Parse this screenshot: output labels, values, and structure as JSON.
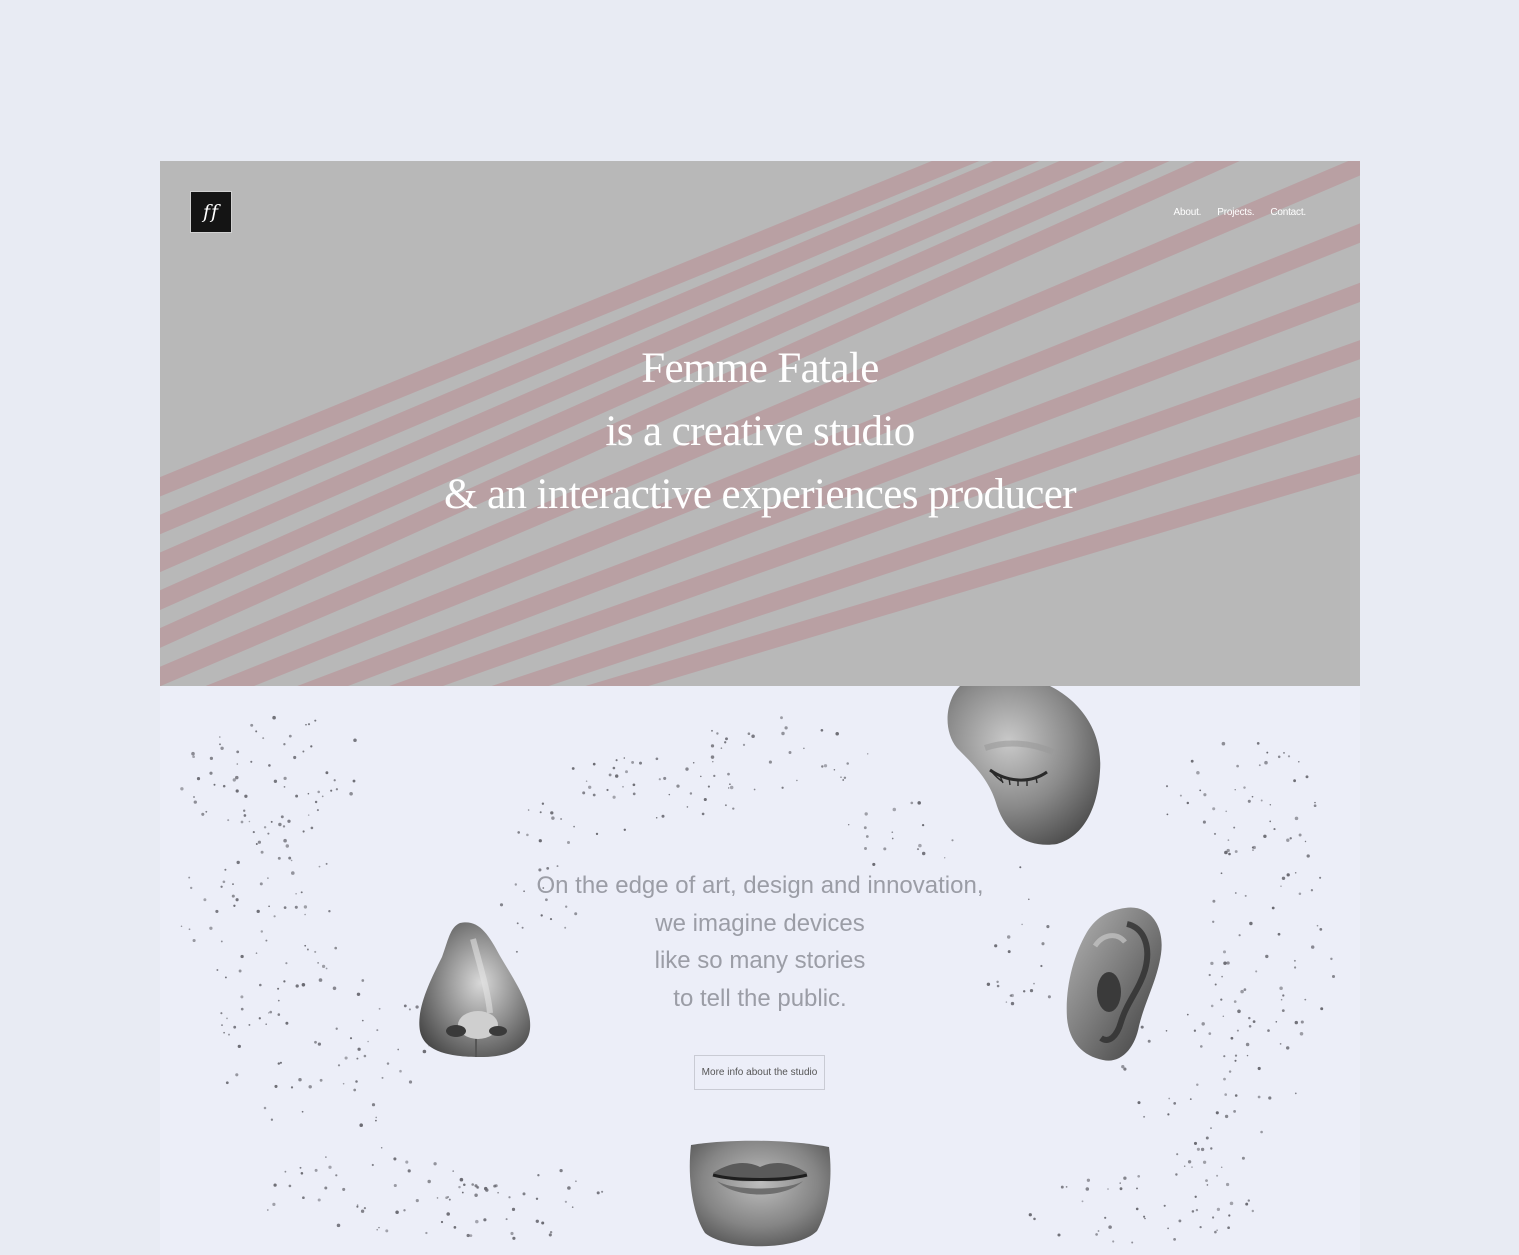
{
  "site": {
    "logo_text": "ff",
    "nav": [
      {
        "label": "About."
      },
      {
        "label": "Projects."
      },
      {
        "label": "Contact."
      }
    ]
  },
  "hero": {
    "lines": [
      "Femme Fatale",
      "is a creative studio",
      "& an interactive experiences producer"
    ]
  },
  "intro": {
    "lines": [
      "On the edge of art, design and innovation,",
      "we imagine devices",
      "like so many stories",
      "to tell the public."
    ],
    "cta_label": "More info about the studio"
  },
  "decor": {
    "images": [
      "closed-eye-sculpture",
      "nose-sculpture",
      "ear-sculpture",
      "lips-sculpture"
    ]
  },
  "colors": {
    "page_bg": "#e8ebf3",
    "hero_bg": "#b8b8b8",
    "stripe": "#b9a0a3",
    "lower_bg": "#eceef8",
    "body_text": "#9b9da6"
  }
}
